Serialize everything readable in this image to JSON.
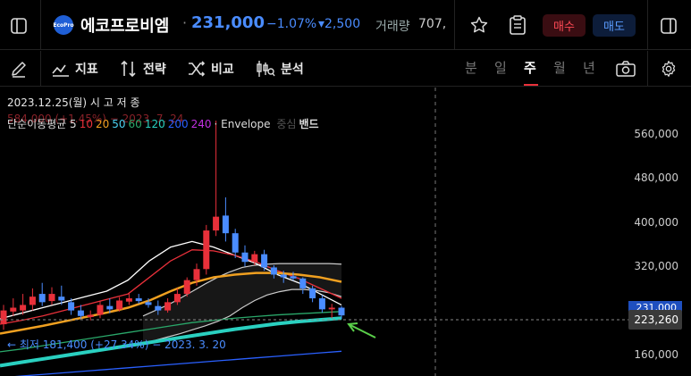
{
  "header": {
    "logo_text": "EcoPro",
    "stock_name": "에코프로비엠",
    "dot": "·",
    "price": "231,000",
    "change_pct": "−1.07%",
    "change_amount": "▾2,500",
    "volume_label": "거래량",
    "volume_value": "707,",
    "buy_label": "매수",
    "sell_label": "매도"
  },
  "toolbar": {
    "indicator_label": "지표",
    "strategy_label": "전략",
    "compare_label": "비교",
    "analysis_label": "분석",
    "periods": [
      "분",
      "일",
      "주",
      "월",
      "년"
    ],
    "active_period": "주"
  },
  "chart": {
    "date_label": "2023.12.25(월)  시  고  저  종",
    "old_label": "584,000 (+1.45%) − 2023. 7. 24",
    "legend": {
      "prefix": "단순이동평균 5",
      "p10": "10",
      "p20": "20",
      "p50": "50",
      "p60": "60",
      "p120": "120",
      "p200": "200",
      "p240": "240",
      "envelope": "· Envelope",
      "env_mid": "중심",
      "env_band": "밴드"
    },
    "low_label": "← 최저 181,400 (+27.34%) − 2023. 3. 20",
    "price_tag": "231,000",
    "crosshair_tag": "223,260"
  },
  "colors": {
    "up": "#e8303a",
    "down": "#4a8cff",
    "ma10": "#e8303a",
    "ma20": "#f0a020",
    "ma50": "#4ad0f0",
    "ma60": "#2aa86a",
    "ma120": "#2ad0c0",
    "ma200": "#2a60ff",
    "ma240": "#c030e0"
  },
  "chart_data": {
    "type": "candlestick",
    "y_tick_labels": [
      "560,000",
      "480,000",
      "400,000",
      "320,000",
      "231,000",
      "223,260",
      "160,000"
    ],
    "ylim": [
      130000,
      600000
    ],
    "current_price": 231000,
    "crosshair_price": 223260,
    "period_high": 584000,
    "period_low": 181400,
    "candles": [
      {
        "o": 215000,
        "c": 240000,
        "h": 250000,
        "l": 205000
      },
      {
        "o": 238000,
        "c": 245000,
        "h": 262000,
        "l": 230000
      },
      {
        "o": 240000,
        "c": 250000,
        "h": 270000,
        "l": 232000
      },
      {
        "o": 250000,
        "c": 265000,
        "h": 280000,
        "l": 240000
      },
      {
        "o": 270000,
        "c": 255000,
        "h": 290000,
        "l": 248000
      },
      {
        "o": 257000,
        "c": 270000,
        "h": 282000,
        "l": 250000
      },
      {
        "o": 265000,
        "c": 258000,
        "h": 285000,
        "l": 250000
      },
      {
        "o": 255000,
        "c": 240000,
        "h": 262000,
        "l": 232000
      },
      {
        "o": 240000,
        "c": 230000,
        "h": 250000,
        "l": 225000
      },
      {
        "o": 228000,
        "c": 232000,
        "h": 240000,
        "l": 222000
      },
      {
        "o": 232000,
        "c": 250000,
        "h": 258000,
        "l": 226000
      },
      {
        "o": 248000,
        "c": 242000,
        "h": 262000,
        "l": 235000
      },
      {
        "o": 242000,
        "c": 258000,
        "h": 264000,
        "l": 238000
      },
      {
        "o": 256000,
        "c": 262000,
        "h": 272000,
        "l": 250000
      },
      {
        "o": 262000,
        "c": 257000,
        "h": 270000,
        "l": 252000
      },
      {
        "o": 255000,
        "c": 250000,
        "h": 262000,
        "l": 245000
      },
      {
        "o": 248000,
        "c": 240000,
        "h": 258000,
        "l": 232000
      },
      {
        "o": 240000,
        "c": 255000,
        "h": 262000,
        "l": 236000
      },
      {
        "o": 255000,
        "c": 270000,
        "h": 280000,
        "l": 250000
      },
      {
        "o": 270000,
        "c": 295000,
        "h": 300000,
        "l": 265000
      },
      {
        "o": 295000,
        "c": 315000,
        "h": 325000,
        "l": 285000
      },
      {
        "o": 315000,
        "c": 385000,
        "h": 395000,
        "l": 305000
      },
      {
        "o": 385000,
        "c": 410000,
        "h": 584000,
        "l": 375000
      },
      {
        "o": 412000,
        "c": 380000,
        "h": 445000,
        "l": 365000
      },
      {
        "o": 380000,
        "c": 345000,
        "h": 388000,
        "l": 335000
      },
      {
        "o": 345000,
        "c": 328000,
        "h": 358000,
        "l": 320000
      },
      {
        "o": 328000,
        "c": 342000,
        "h": 348000,
        "l": 322000
      },
      {
        "o": 342000,
        "c": 318000,
        "h": 350000,
        "l": 312000
      },
      {
        "o": 318000,
        "c": 305000,
        "h": 322000,
        "l": 298000
      },
      {
        "o": 305000,
        "c": 300000,
        "h": 312000,
        "l": 290000
      },
      {
        "o": 302000,
        "c": 298000,
        "h": 310000,
        "l": 294000
      },
      {
        "o": 298000,
        "c": 280000,
        "h": 300000,
        "l": 270000
      },
      {
        "o": 280000,
        "c": 262000,
        "h": 285000,
        "l": 255000
      },
      {
        "o": 262000,
        "c": 242000,
        "h": 268000,
        "l": 236000
      },
      {
        "o": 242000,
        "c": 245000,
        "h": 252000,
        "l": 226000
      },
      {
        "o": 245000,
        "c": 231000,
        "h": 248000,
        "l": 225000
      }
    ],
    "moving_averages": [
      {
        "name": "5",
        "color": "#ffffff",
        "values": [
          225000,
          235000,
          245000,
          255000,
          265000,
          275000,
          295000,
          330000,
          355000,
          365000,
          355000,
          340000,
          325000,
          305000,
          290000,
          270000,
          250000
        ]
      },
      {
        "name": "10",
        "color": "#e8303a",
        "values": [
          215000,
          222000,
          230000,
          240000,
          250000,
          260000,
          270000,
          300000,
          330000,
          350000,
          348000,
          340000,
          328000,
          312000,
          298000,
          280000,
          262000
        ]
      },
      {
        "name": "20",
        "color": "#f0a020",
        "values": [
          198000,
          205000,
          212000,
          220000,
          228000,
          236000,
          245000,
          258000,
          275000,
          290000,
          300000,
          305000,
          308000,
          308000,
          305000,
          300000,
          292000
        ]
      },
      {
        "name": "60",
        "color": "#2aa86a",
        "values": [
          165000,
          170000,
          176000,
          182000,
          188000,
          194000,
          200000,
          206000,
          212000,
          218000,
          222000,
          226000,
          229000,
          232000,
          234000,
          236000,
          238000
        ]
      },
      {
        "name": "120",
        "color": "#2ad0c0",
        "values": [
          140000,
          146000,
          152000,
          158000,
          164000,
          170000,
          176000,
          182000,
          188000,
          194000,
          200000,
          206000,
          211000,
          216000,
          220000,
          223000,
          226000
        ]
      },
      {
        "name": "200",
        "color": "#2a60ff",
        "values": [
          118000,
          121000,
          124000,
          127000,
          130000,
          133000,
          136000,
          139000,
          142000,
          145000,
          148000,
          151000,
          154000,
          157000,
          160000,
          163000,
          166000
        ]
      }
    ],
    "envelope": {
      "upper": [
        230000,
        240000,
        250000,
        262000,
        275000,
        288000,
        300000,
        310000,
        318000,
        322000,
        324000,
        325000,
        325000,
        325000,
        325000,
        325000,
        324000
      ],
      "lower": [
        180000,
        186000,
        192000,
        198000,
        205000,
        212000,
        220000,
        230000,
        245000,
        258000,
        268000,
        274000,
        278000,
        278000,
        276000,
        272000,
        265000
      ]
    }
  }
}
